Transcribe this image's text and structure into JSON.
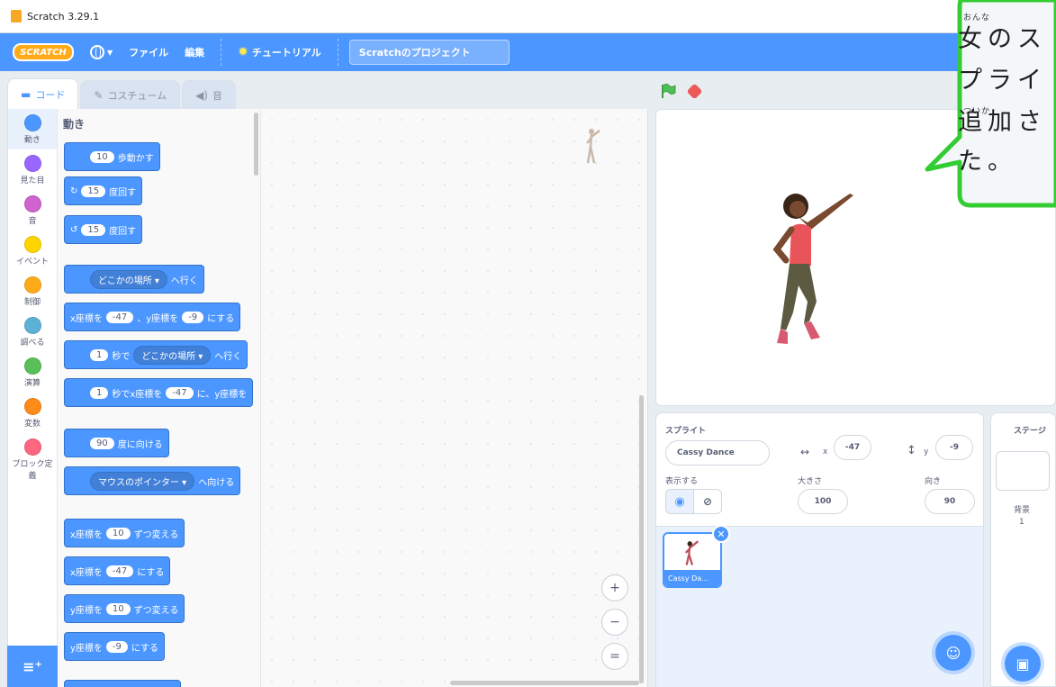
{
  "window": {
    "title": "Scratch 3.29.1"
  },
  "menu": {
    "logo": "SCRATCH",
    "file": "ファイル",
    "edit": "編集",
    "tutorial": "チュートリアル",
    "project_title": "Scratchのプロジェクト"
  },
  "tabs": {
    "code": "コード",
    "costume": "コスチューム",
    "sound": "音"
  },
  "categories": [
    {
      "label": "動き",
      "color": "#4c97ff"
    },
    {
      "label": "見た目",
      "color": "#9966ff"
    },
    {
      "label": "音",
      "color": "#cf63cf"
    },
    {
      "label": "イベント",
      "color": "#ffd500"
    },
    {
      "label": "制御",
      "color": "#ffab19"
    },
    {
      "label": "調べる",
      "color": "#5cb1d6"
    },
    {
      "label": "演算",
      "color": "#59c059"
    },
    {
      "label": "変数",
      "color": "#ff8c1a"
    },
    {
      "label": "ブロック定義",
      "color": "#ff6680"
    }
  ],
  "palette": {
    "section_title": "動き",
    "move": {
      "value": "10",
      "text": "歩動かす"
    },
    "turn_right": {
      "value": "15",
      "text": "度回す"
    },
    "turn_left": {
      "value": "15",
      "text": "度回す"
    },
    "goto": {
      "menu": "どこかの場所 ▾",
      "text": "へ行く"
    },
    "gotoxy": {
      "x_label": "x座標を",
      "x": "-47",
      "sep": "、y座標を",
      "y": "-9",
      "text": "にする"
    },
    "glide_to": {
      "secs": "1",
      "mid": "秒で",
      "menu": "どこかの場所 ▾",
      "text": "へ行く"
    },
    "glide_xy": {
      "secs": "1",
      "mid": "秒でx座標を",
      "x": "-47",
      "text": "に、y座標を"
    },
    "point_dir": {
      "value": "90",
      "text": "度に向ける"
    },
    "point_towards": {
      "menu": "マウスのポインター ▾",
      "text": "へ向ける"
    },
    "change_x": {
      "label": "x座標を",
      "value": "10",
      "text": "ずつ変える"
    },
    "set_x": {
      "label": "x座標を",
      "value": "-47",
      "text": "にする"
    },
    "change_y": {
      "label": "y座標を",
      "value": "10",
      "text": "ずつ変える"
    },
    "set_y": {
      "label": "y座標を",
      "value": "-9",
      "text": "にする"
    }
  },
  "zoom": {
    "in": "+",
    "out": "−",
    "reset": "="
  },
  "sprite_info": {
    "heading": "スプライト",
    "name": "Cassy Dance",
    "x_label": "x",
    "x": "-47",
    "y_label": "y",
    "y": "-9",
    "show_label": "表示する",
    "size_label": "大きさ",
    "size": "100",
    "direction_label": "向き",
    "direction": "90"
  },
  "sprites": [
    {
      "name": "Cassy Da..."
    }
  ],
  "stage_pane": {
    "heading": "ステージ",
    "backdrops_label": "背景",
    "backdrops_count": "1"
  },
  "callout": {
    "ruby_onna": "おんな",
    "ruby_tsuika": "ついか",
    "line1": "女のス",
    "line2": "プライ",
    "line3": "追加さ",
    "line4": "た。"
  }
}
